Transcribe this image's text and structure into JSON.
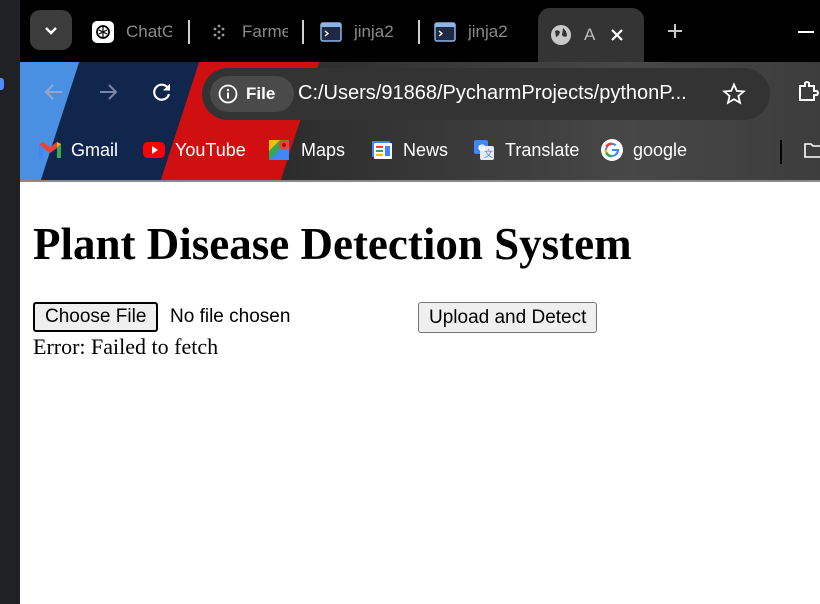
{
  "browser": {
    "tabs": [
      {
        "title": "ChatG",
        "icon": "chatgpt-icon"
      },
      {
        "title": "Farme",
        "icon": "dots-icon"
      },
      {
        "title": "jinja2",
        "icon": "terminal-icon"
      },
      {
        "title": "jinja2",
        "icon": "terminal-icon"
      },
      {
        "title": "A",
        "icon": "globe-icon",
        "active": true
      }
    ],
    "address": {
      "chip_label": "File",
      "url": "C:/Users/91868/PycharmProjects/pythonP..."
    },
    "bookmarks": [
      {
        "label": "Gmail",
        "icon": "gmail-icon"
      },
      {
        "label": "YouTube",
        "icon": "youtube-icon"
      },
      {
        "label": "Maps",
        "icon": "maps-icon"
      },
      {
        "label": "News",
        "icon": "news-icon"
      },
      {
        "label": "Translate",
        "icon": "translate-icon"
      },
      {
        "label": "google",
        "icon": "google-icon"
      }
    ]
  },
  "page": {
    "title": "Plant Disease Detection System",
    "choose_file_label": "Choose File",
    "no_file_text": "No file chosen",
    "upload_button_label": "Upload and Detect",
    "error_text": "Error: Failed to fetch"
  },
  "colors": {
    "accent_blue": "#4a90e2",
    "theme_red": "#d01010",
    "omnibox_bg": "#333333"
  }
}
